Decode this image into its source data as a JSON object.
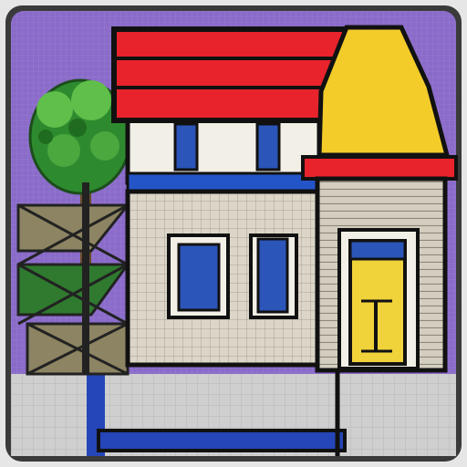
{
  "image": {
    "subject": "house-illustration",
    "colors": {
      "sky": "#8a6bc9",
      "frame": "#d9d9d9",
      "roof_red": "#e8232b",
      "roof_yellow": "#f3cc2a",
      "wall_cream": "#f2f0e6",
      "brick_grid": "#cfc7b8",
      "window_blue": "#2b55b8",
      "door_yellow": "#f0d23a",
      "tree_green": "#2e8a2e",
      "tree_light": "#5fbf4a",
      "fence_olive": "#8c8462",
      "siding": "#d4cec0",
      "pavement": "#cfcfcf",
      "outline": "#111111",
      "trim_blue": "#2455c8"
    },
    "elements": [
      "photo-frame",
      "sky-background",
      "tree",
      "fence",
      "main-house",
      "red-roof",
      "yellow-gable",
      "upper-windows",
      "lower-windows",
      "side-annex",
      "yellow-door",
      "pavement"
    ]
  }
}
